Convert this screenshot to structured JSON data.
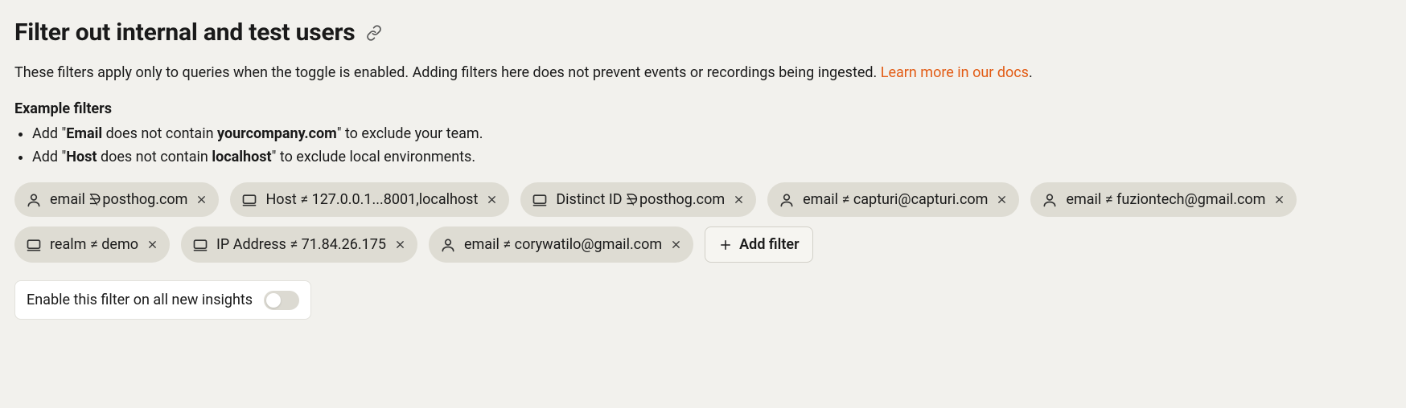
{
  "header": {
    "title": "Filter out internal and test users"
  },
  "description": {
    "text": "These filters apply only to queries when the toggle is enabled. Adding filters here does not prevent events or recordings being ingested. ",
    "link": "Learn more in our docs",
    "period": "."
  },
  "examples": {
    "heading": "Example filters",
    "items": [
      {
        "pre": "Add \"",
        "b1": "Email",
        "mid": " does not contain ",
        "b2": "yourcompany.com",
        "post": "\" to exclude your team."
      },
      {
        "pre": "Add \"",
        "b1": "Host",
        "mid": " does not contain ",
        "b2": "localhost",
        "post": "\" to exclude local environments."
      }
    ]
  },
  "filters": [
    {
      "icon": "person",
      "prop": "email",
      "op": "not_contains",
      "value": "posthog.com"
    },
    {
      "icon": "device",
      "prop": "Host",
      "op": "not_equal",
      "value": "127.0.0.1...8001,localhost"
    },
    {
      "icon": "device",
      "prop": "Distinct ID",
      "op": "not_contains",
      "value": "posthog.com"
    },
    {
      "icon": "person",
      "prop": "email",
      "op": "not_equal",
      "value": "capturi@capturi.com"
    },
    {
      "icon": "person",
      "prop": "email",
      "op": "not_equal",
      "value": "fuziontech@gmail.com"
    },
    {
      "icon": "device",
      "prop": "realm",
      "op": "not_equal",
      "value": "demo"
    },
    {
      "icon": "device",
      "prop": "IP Address",
      "op": "not_equal",
      "value": "71.84.26.175"
    },
    {
      "icon": "person",
      "prop": "email",
      "op": "not_equal",
      "value": "corywatilo@gmail.com"
    }
  ],
  "add_filter_label": "Add filter",
  "toggle": {
    "label": "Enable this filter on all new insights",
    "enabled": false
  }
}
